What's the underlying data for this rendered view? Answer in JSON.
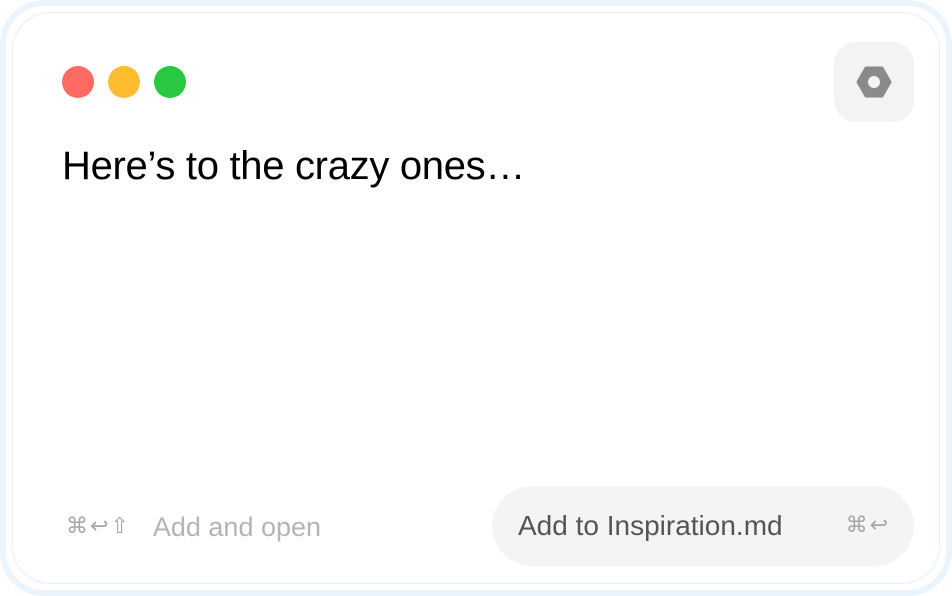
{
  "window": {
    "traffic_lights": [
      {
        "name": "close",
        "color": "#ff6b63"
      },
      {
        "name": "minimize",
        "color": "#febc2e"
      },
      {
        "name": "zoom",
        "color": "#28c840"
      }
    ],
    "settings_icon": "gear-icon"
  },
  "content": {
    "text": "Here’s to the crazy ones…"
  },
  "footer": {
    "secondary_action": {
      "shortcut_keys": [
        "⌘",
        "↩",
        "⇧"
      ],
      "label": "Add and open"
    },
    "primary_action": {
      "label": "Add to Inspiration.md",
      "shortcut_keys": [
        "⌘",
        "↩"
      ]
    }
  }
}
